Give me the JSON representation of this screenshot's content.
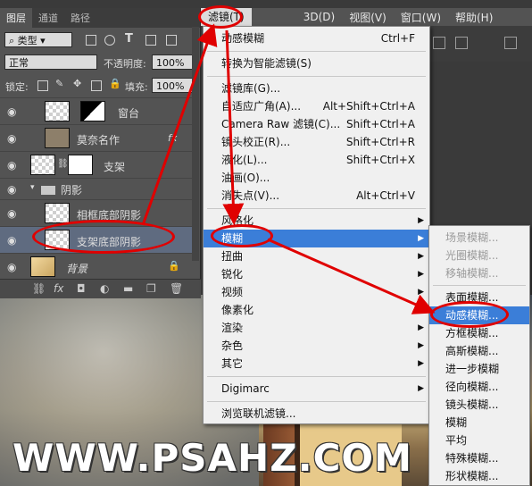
{
  "canvas": {
    "watermark": "WWW.PSAHZ.COM"
  },
  "menubar": {
    "items": [
      "滤镜(T)",
      "3D(D)",
      "视图(V)",
      "窗口(W)",
      "帮助(H)"
    ]
  },
  "layers_panel": {
    "tabs": [
      "图层",
      "通道",
      "路径"
    ],
    "filter_kind": "类型",
    "blend_mode": "正常",
    "opacity_label": "不透明度:",
    "opacity_value": "100%",
    "lock_label": "锁定:",
    "fill_label": "填充:",
    "fill_value": "100%",
    "layers": [
      {
        "name": "窗台"
      },
      {
        "name": "莫奈名作",
        "fx": "fx"
      },
      {
        "name": "支架"
      },
      {
        "name": "阴影"
      },
      {
        "name": "相框底部阴影"
      },
      {
        "name": "支架底部阴影"
      },
      {
        "name": "背景"
      }
    ],
    "bottom_icons": [
      "link-icon",
      "fx-icon",
      "mask-icon",
      "adjustment-icon",
      "group-icon",
      "new-layer-icon",
      "trash-icon"
    ],
    "fx_glyph": "fx"
  },
  "filter_menu": {
    "items": [
      {
        "label": "动感模糊",
        "shortcut": "Ctrl+F"
      },
      {
        "label": "转换为智能滤镜(S)",
        "shortcut": ""
      },
      {
        "label": "滤镜库(G)...",
        "shortcut": ""
      },
      {
        "label": "自适应广角(A)...",
        "shortcut": "Alt+Shift+Ctrl+A"
      },
      {
        "label": "Camera Raw 滤镜(C)...",
        "shortcut": "Shift+Ctrl+A"
      },
      {
        "label": "镜头校正(R)...",
        "shortcut": "Shift+Ctrl+R"
      },
      {
        "label": "液化(L)...",
        "shortcut": "Shift+Ctrl+X"
      },
      {
        "label": "油画(O)...",
        "shortcut": ""
      },
      {
        "label": "消失点(V)...",
        "shortcut": "Alt+Ctrl+V"
      },
      {
        "label": "风格化",
        "shortcut": ""
      },
      {
        "label": "模糊",
        "shortcut": ""
      },
      {
        "label": "扭曲",
        "shortcut": ""
      },
      {
        "label": "锐化",
        "shortcut": ""
      },
      {
        "label": "视频",
        "shortcut": ""
      },
      {
        "label": "像素化",
        "shortcut": ""
      },
      {
        "label": "渲染",
        "shortcut": ""
      },
      {
        "label": "杂色",
        "shortcut": ""
      },
      {
        "label": "其它",
        "shortcut": ""
      },
      {
        "label": "Digimarc",
        "shortcut": ""
      },
      {
        "label": "浏览联机滤镜...",
        "shortcut": ""
      }
    ]
  },
  "blur_submenu": {
    "items": [
      {
        "label": "场景模糊...",
        "disabled": true
      },
      {
        "label": "光圈模糊...",
        "disabled": true
      },
      {
        "label": "移轴模糊...",
        "disabled": true
      },
      {
        "label": "表面模糊...",
        "disabled": false
      },
      {
        "label": "动感模糊...",
        "disabled": false
      },
      {
        "label": "方框模糊...",
        "disabled": false
      },
      {
        "label": "高斯模糊...",
        "disabled": false
      },
      {
        "label": "进一步模糊",
        "disabled": false
      },
      {
        "label": "径向模糊...",
        "disabled": false
      },
      {
        "label": "镜头模糊...",
        "disabled": false
      },
      {
        "label": "模糊",
        "disabled": false
      },
      {
        "label": "平均",
        "disabled": false
      },
      {
        "label": "特殊模糊...",
        "disabled": false
      },
      {
        "label": "形状模糊...",
        "disabled": false
      }
    ]
  },
  "colors": {
    "highlight": "#3b7ed8",
    "annotation": "#e00000",
    "selected_layer": "#5f6b80"
  }
}
